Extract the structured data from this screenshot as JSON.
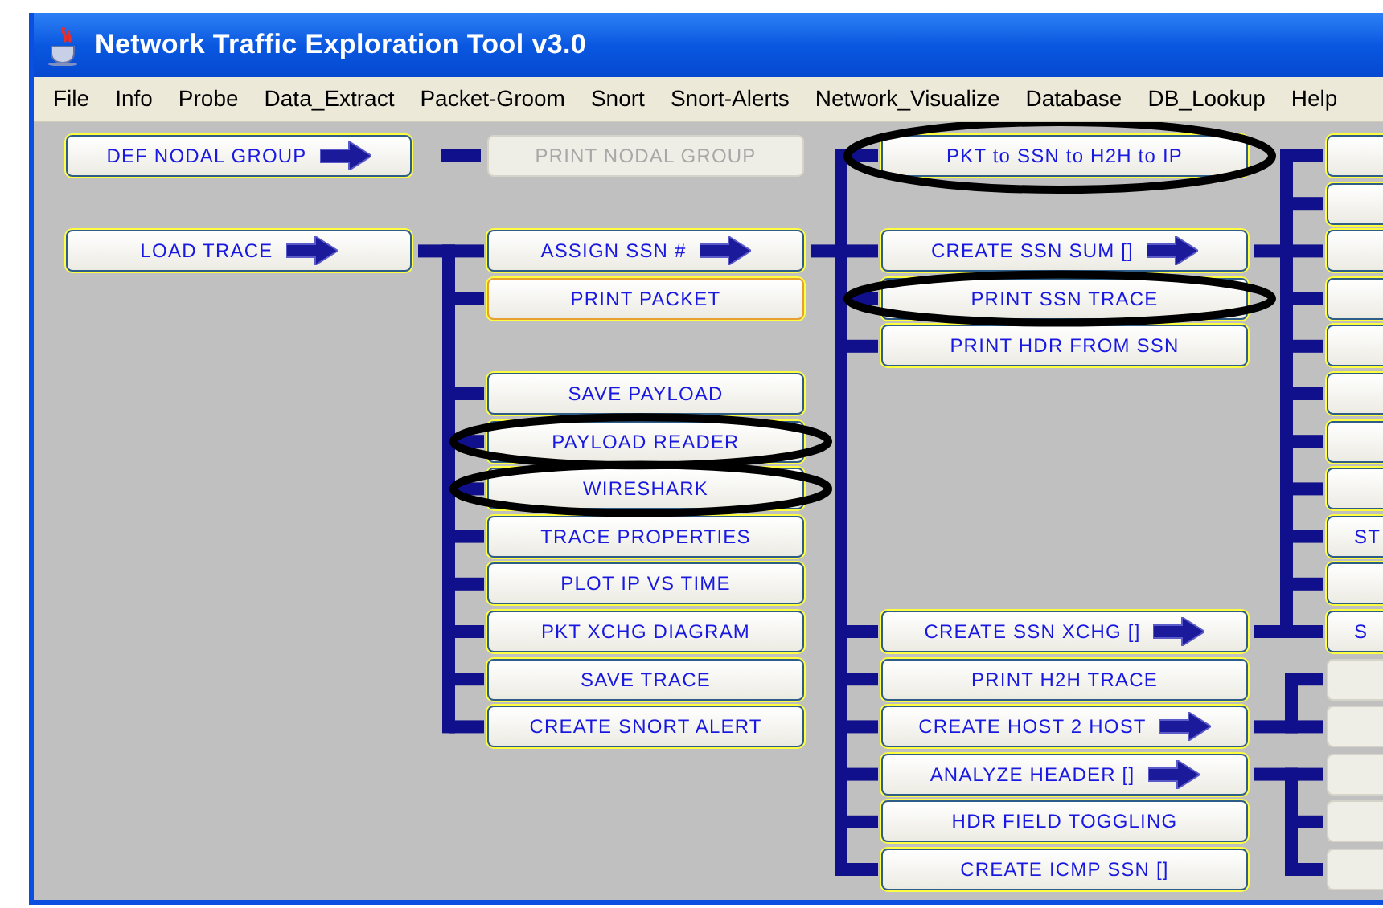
{
  "window": {
    "title": "Network Traffic Exploration Tool v3.0"
  },
  "menu": [
    "File",
    "Info",
    "Probe",
    "Data_Extract",
    "Packet-Groom",
    "Snort",
    "Snort-Alerts",
    "Network_Visualize",
    "Database",
    "DB_Lookup",
    "Help"
  ],
  "columns": [
    {
      "buttons": [
        {
          "label": "DEF NODAL GROUP",
          "arrow": true,
          "disabled": false,
          "focused": false,
          "circled": false
        },
        {
          "label": "LOAD TRACE",
          "arrow": true,
          "disabled": false,
          "focused": false,
          "circled": false
        }
      ]
    },
    {
      "buttons": [
        {
          "label": "PRINT NODAL GROUP",
          "arrow": false,
          "disabled": true,
          "focused": false,
          "circled": false
        },
        {
          "label": "ASSIGN SSN #",
          "arrow": true,
          "disabled": false,
          "focused": false,
          "circled": false
        },
        {
          "label": "PRINT PACKET",
          "arrow": false,
          "disabled": false,
          "focused": true,
          "circled": false
        },
        {
          "label": "SAVE  PAYLOAD",
          "arrow": false,
          "disabled": false,
          "focused": false,
          "circled": false
        },
        {
          "label": "PAYLOAD READER",
          "arrow": false,
          "disabled": false,
          "focused": false,
          "circled": true
        },
        {
          "label": "WIRESHARK",
          "arrow": false,
          "disabled": false,
          "focused": false,
          "circled": true
        },
        {
          "label": "TRACE PROPERTIES",
          "arrow": false,
          "disabled": false,
          "focused": false,
          "circled": false
        },
        {
          "label": "PLOT IP VS TIME",
          "arrow": false,
          "disabled": false,
          "focused": false,
          "circled": false
        },
        {
          "label": "PKT XCHG DIAGRAM",
          "arrow": false,
          "disabled": false,
          "focused": false,
          "circled": false
        },
        {
          "label": "SAVE TRACE",
          "arrow": false,
          "disabled": false,
          "focused": false,
          "circled": false
        },
        {
          "label": "CREATE SNORT ALERT",
          "arrow": false,
          "disabled": false,
          "focused": false,
          "circled": false
        }
      ]
    },
    {
      "buttons": [
        {
          "label": "PKT to SSN to H2H to IP",
          "arrow": false,
          "disabled": false,
          "focused": false,
          "circled": true
        },
        {
          "label": "CREATE SSN SUM []",
          "arrow": true,
          "disabled": false,
          "focused": false,
          "circled": false
        },
        {
          "label": "PRINT SSN TRACE",
          "arrow": false,
          "disabled": false,
          "focused": false,
          "circled": true
        },
        {
          "label": "PRINT HDR FROM SSN",
          "arrow": false,
          "disabled": false,
          "focused": false,
          "circled": false
        },
        {
          "label": "CREATE SSN XCHG []",
          "arrow": true,
          "disabled": false,
          "focused": false,
          "circled": false
        },
        {
          "label": "PRINT H2H TRACE",
          "arrow": false,
          "disabled": false,
          "focused": false,
          "circled": false
        },
        {
          "label": "CREATE HOST 2 HOST",
          "arrow": true,
          "disabled": false,
          "focused": false,
          "circled": false
        },
        {
          "label": "ANALYZE HEADER []",
          "arrow": true,
          "disabled": false,
          "focused": false,
          "circled": false
        },
        {
          "label": "HDR FIELD TOGGLING",
          "arrow": false,
          "disabled": false,
          "focused": false,
          "circled": false
        },
        {
          "label": "CREATE ICMP SSN []",
          "arrow": false,
          "disabled": false,
          "focused": false,
          "circled": false
        }
      ]
    },
    {
      "buttons": [
        {
          "arrow": false,
          "disabled": false,
          "focused": false,
          "circled": false
        },
        {
          "arrow": false,
          "disabled": false,
          "focused": false,
          "circled": false
        },
        {
          "arrow": false,
          "disabled": false,
          "focused": false,
          "circled": false
        },
        {
          "arrow": false,
          "disabled": false,
          "focused": false,
          "circled": false
        },
        {
          "arrow": false,
          "disabled": false,
          "focused": false,
          "circled": false
        },
        {
          "arrow": false,
          "disabled": false,
          "focused": false,
          "circled": false
        },
        {
          "arrow": false,
          "disabled": false,
          "focused": false,
          "circled": false
        },
        {
          "arrow": false,
          "disabled": false,
          "focused": false,
          "circled": false
        },
        {
          "label": "ST",
          "disabled": false,
          "focused": false,
          "circled": false
        },
        {
          "arrow": false,
          "disabled": false,
          "focused": false,
          "circled": false
        },
        {
          "label": "S",
          "disabled": false,
          "focused": false,
          "circled": false
        },
        {
          "arrow": false,
          "disabled": true,
          "focused": false,
          "circled": false
        },
        {
          "arrow": false,
          "disabled": true,
          "focused": false,
          "circled": false
        },
        {
          "arrow": false,
          "disabled": true,
          "focused": false,
          "circled": false
        },
        {
          "arrow": false,
          "disabled": true,
          "focused": false,
          "circled": false
        },
        {
          "arrow": false,
          "disabled": true,
          "focused": false,
          "circled": false
        }
      ]
    }
  ]
}
